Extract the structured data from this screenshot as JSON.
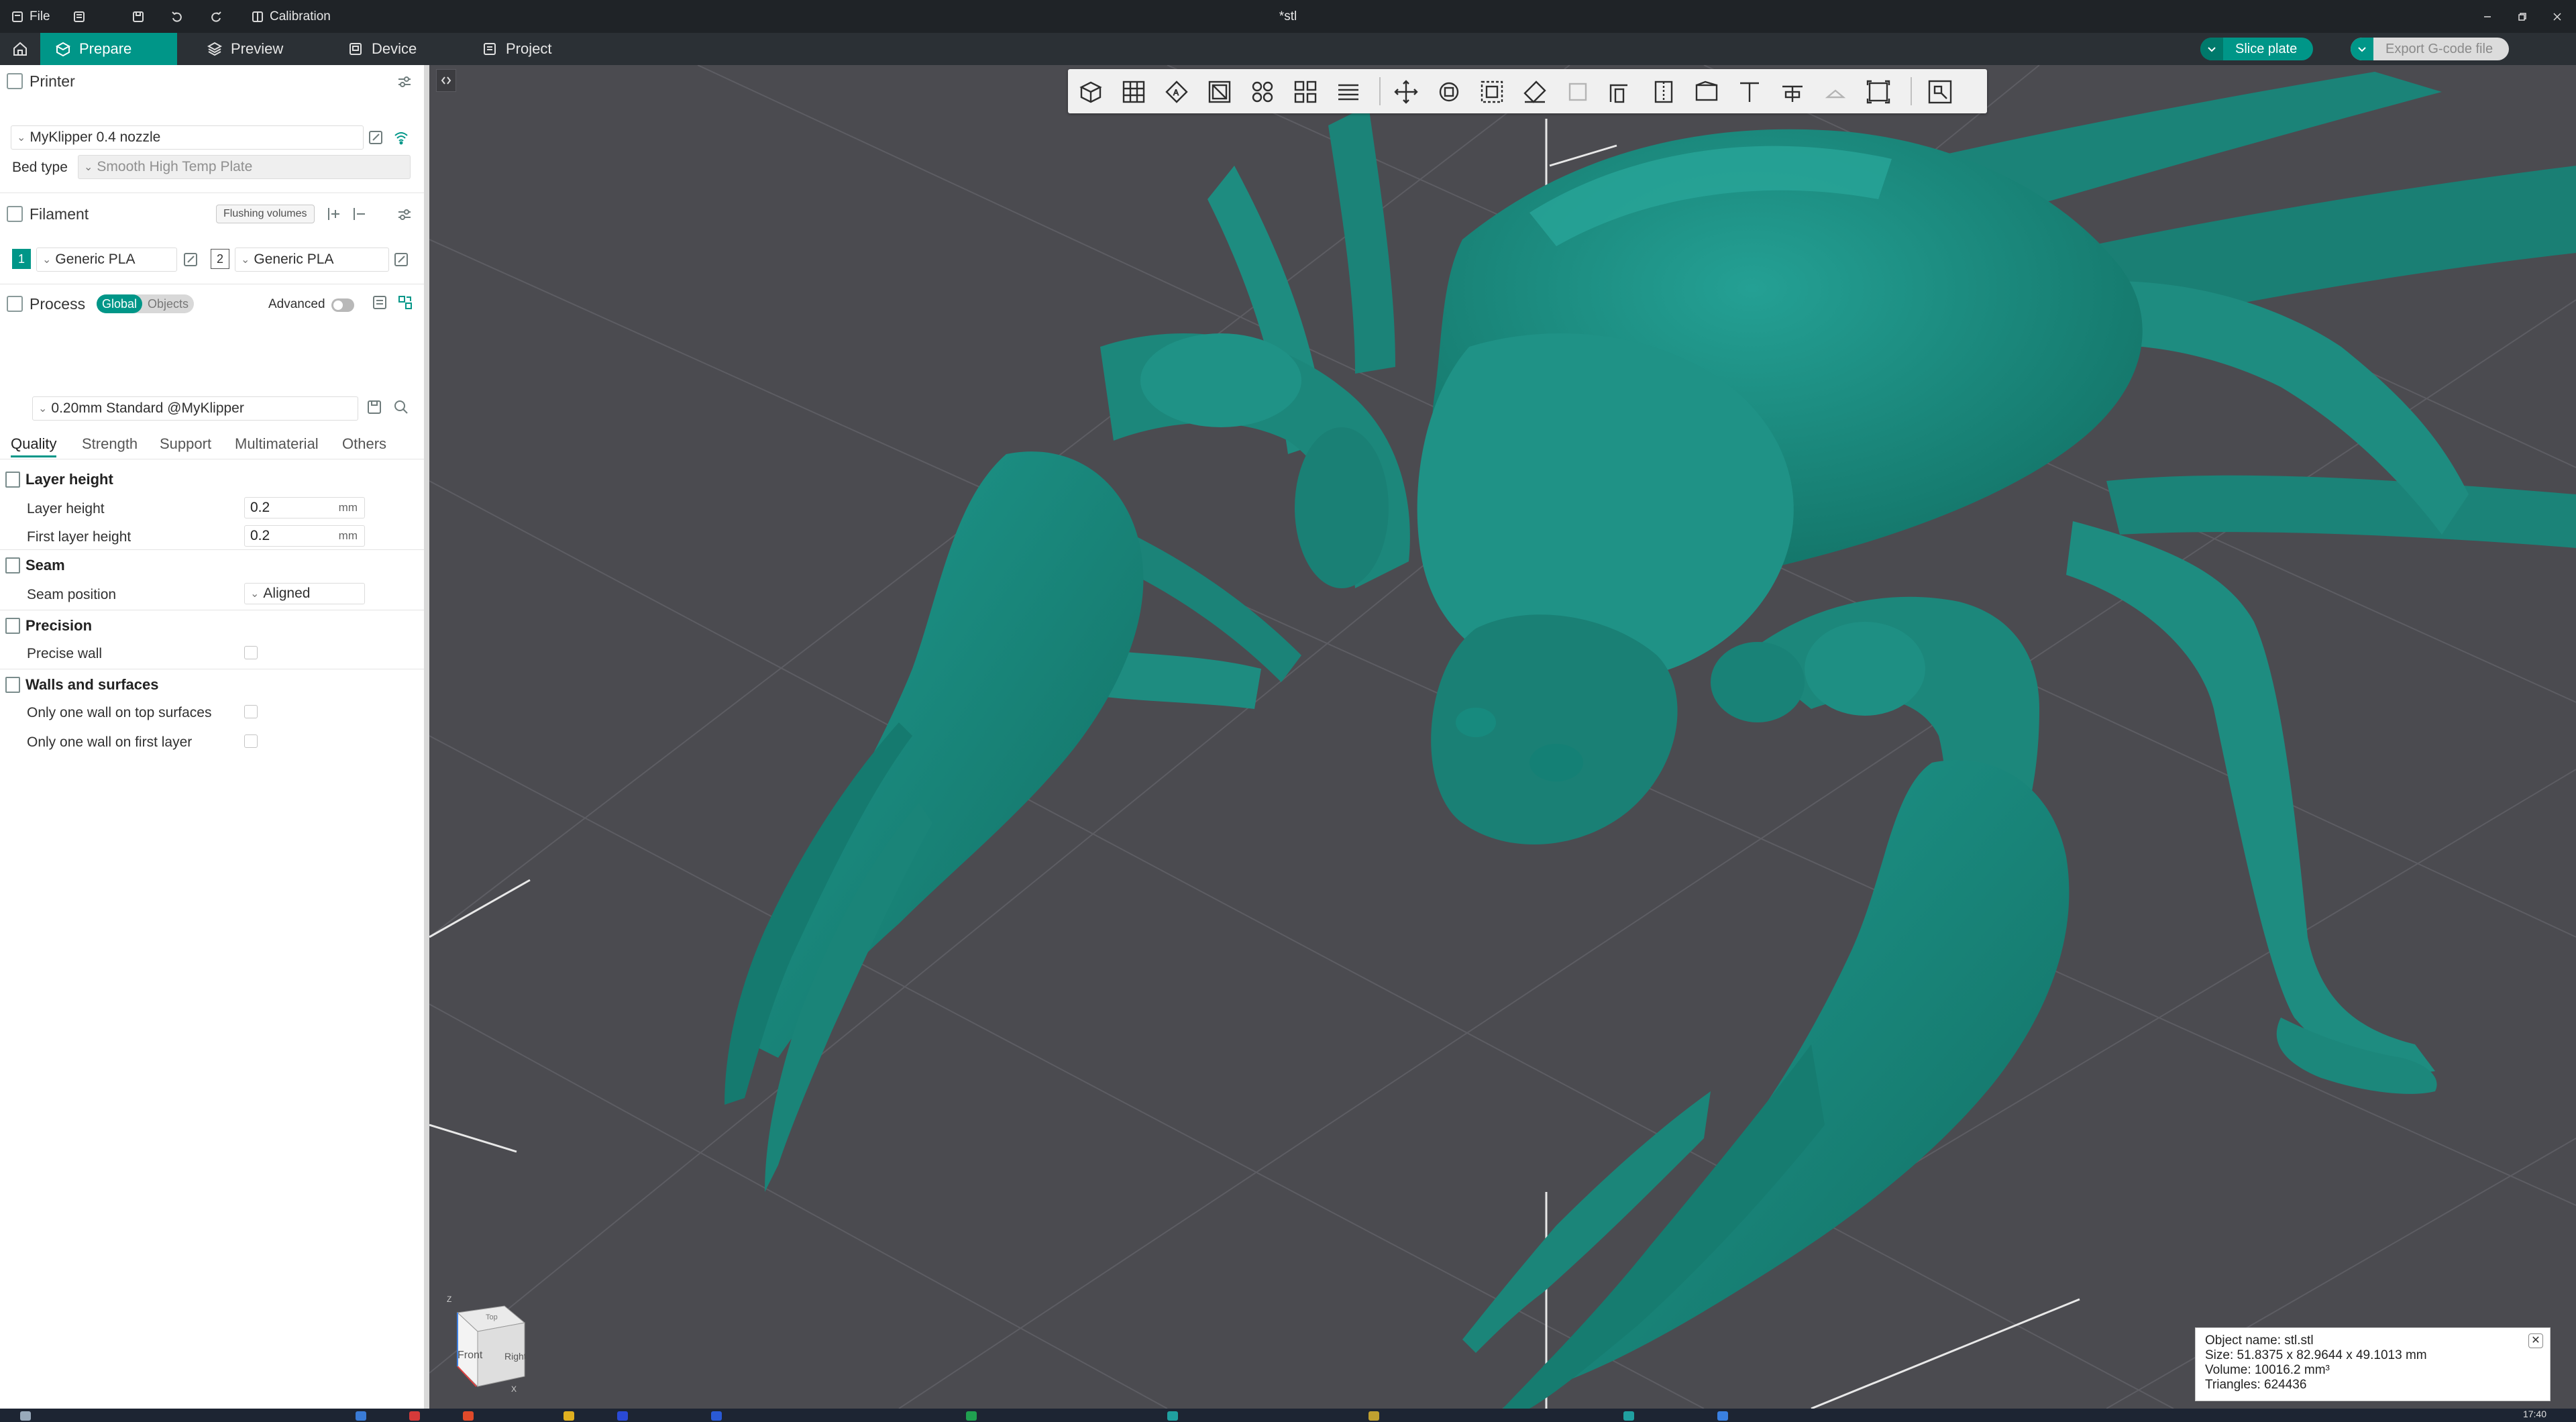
{
  "titlebar": {
    "file_label": "File",
    "calibration_label": "Calibration",
    "window_title": "*stl"
  },
  "nav": {
    "prepare": "Prepare",
    "preview": "Preview",
    "device": "Device",
    "project": "Project",
    "slice_plate": "Slice plate",
    "export_gcode": "Export G-code file"
  },
  "printer": {
    "section_title": "Printer",
    "printer_name": "MyKlipper 0.4 nozzle",
    "bed_type_label": "Bed type",
    "bed_type_value": "Smooth High Temp Plate"
  },
  "filament": {
    "section_title": "Filament",
    "flushing_volumes": "Flushing volumes",
    "slots": [
      {
        "index": "1",
        "name": "Generic PLA",
        "color": "#009688"
      },
      {
        "index": "2",
        "name": "Generic PLA",
        "color": "#ffffff"
      }
    ]
  },
  "process": {
    "section_title": "Process",
    "global_label": "Global",
    "objects_label": "Objects",
    "advanced_label": "Advanced",
    "advanced_on": false,
    "preset": "0.20mm Standard @MyKlipper"
  },
  "tabs": [
    "Quality",
    "Strength",
    "Support",
    "Multimaterial",
    "Others"
  ],
  "active_tab": "Quality",
  "quality": {
    "layer_height_group": "Layer height",
    "layer_height_label": "Layer height",
    "layer_height_value": "0.2",
    "first_layer_height_label": "First layer height",
    "first_layer_height_value": "0.2",
    "unit": "mm",
    "seam_group": "Seam",
    "seam_position_label": "Seam position",
    "seam_position_value": "Aligned",
    "precision_group": "Precision",
    "precise_wall_label": "Precise wall",
    "precise_wall_checked": false,
    "walls_group": "Walls and surfaces",
    "one_wall_top_label": "Only one wall on top surfaces",
    "one_wall_top_checked": false,
    "one_wall_first_label": "Only one wall on first layer",
    "one_wall_first_checked": false
  },
  "viewcube": {
    "front": "Front",
    "right": "Right",
    "top": "Top",
    "axis_z": "Z",
    "axis_x": "X"
  },
  "object_info": {
    "name_line": "Object name: stl.stl",
    "size_line": "Size: 51.8375 x 82.9644 x 49.1013 mm",
    "volume_line": "Volume: 10016.2 mm³",
    "triangles_line": "Triangles: 624436"
  },
  "clock": "17:40",
  "colors": {
    "accent": "#009688",
    "model": "#1d8d83",
    "viewport_bg": "#4b4b50",
    "topbar": "#1f2327",
    "navbar": "#2b3035"
  }
}
